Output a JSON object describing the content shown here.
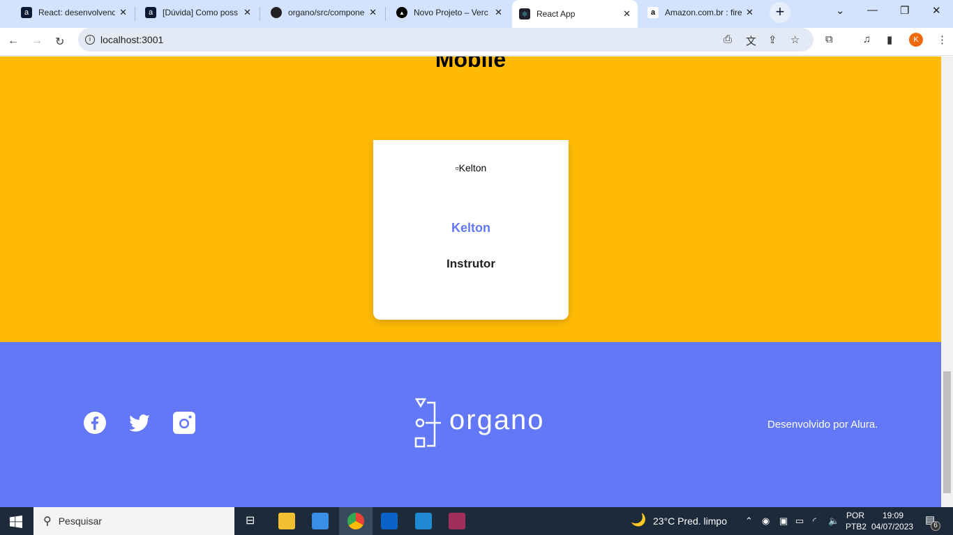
{
  "browser": {
    "tabs": [
      {
        "title": "React: desenvolvend",
        "icon": "alura-icon"
      },
      {
        "title": "[Dúvida] Como poss",
        "icon": "alura-icon"
      },
      {
        "title": "organo/src/compone",
        "icon": "github-icon"
      },
      {
        "title": "Novo Projeto – Verc",
        "icon": "vercel-icon"
      },
      {
        "title": "React App",
        "icon": "react-icon",
        "active": true
      },
      {
        "title": "Amazon.com.br : fire",
        "icon": "amazon-icon"
      }
    ],
    "url": "localhost:3001",
    "profile_initial": "K",
    "profile_color": "#f06b0f"
  },
  "page": {
    "section_title": "Mobile",
    "section_color": "#ffba05",
    "card": {
      "image_alt": "Kelton",
      "name": "Kelton",
      "role": "Instrutor"
    },
    "footer": {
      "brand": "organo",
      "credit": "Desenvolvido por Alura.",
      "color": "#6278f7",
      "social": [
        "facebook",
        "twitter",
        "instagram"
      ]
    }
  },
  "taskbar": {
    "search_placeholder": "Pesquisar",
    "weather": "23°C  Pred. limpo",
    "lang1": "POR",
    "lang2": "PTB2",
    "time": "19:09",
    "date": "04/07/2023",
    "notifications": "6"
  }
}
